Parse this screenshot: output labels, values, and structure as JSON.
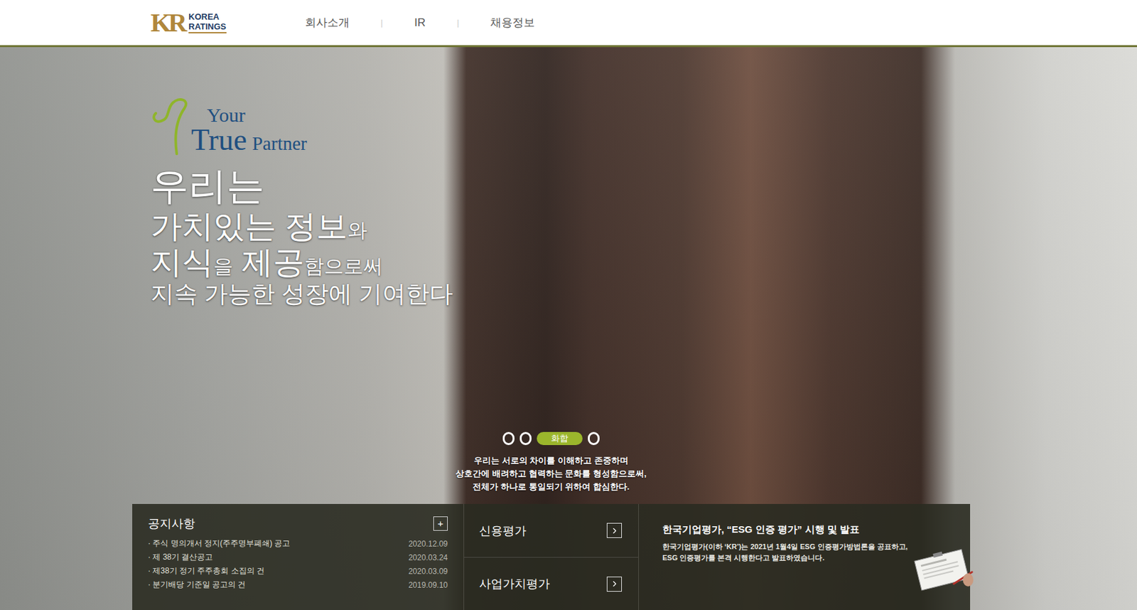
{
  "header": {
    "logo": {
      "mark": "KR",
      "name_lines": [
        "KOREA",
        "RATINGS"
      ]
    },
    "nav": [
      {
        "label": "회사소개"
      },
      {
        "label": "IR"
      },
      {
        "label": "채용정보"
      }
    ],
    "separator": "|"
  },
  "hero": {
    "tagline": {
      "small_top": "Your",
      "large": "True",
      "small_end": "Partner"
    },
    "headline": [
      [
        {
          "text": "우리는",
          "kind": "xl"
        }
      ],
      [
        {
          "text": "가치있는 정보",
          "kind": "large"
        },
        {
          "text": "와",
          "kind": "small"
        }
      ],
      [
        {
          "text": "지식",
          "kind": "large"
        },
        {
          "text": "을",
          "kind": "small"
        },
        {
          "text": " 제공",
          "kind": "large"
        },
        {
          "text": "함으로써",
          "kind": "small"
        }
      ],
      [
        {
          "text": "지속 가능한 성장에 기여한다",
          "kind": "medium"
        }
      ]
    ]
  },
  "slider": {
    "dots": [
      {
        "label": "",
        "selected": false
      },
      {
        "label": "",
        "selected": false
      },
      {
        "label": "화합",
        "selected": true
      },
      {
        "label": "",
        "selected": false
      }
    ],
    "caption": [
      "우리는 서로의 차이를 이해하고 존중하며",
      "상호간에 배려하고 협력하는 문화를 형성함으로써,",
      "전체가 하나로 통일되기 위하여 합심한다."
    ]
  },
  "notices": {
    "title": "공지사항",
    "more": "+",
    "bullet": "·",
    "items": [
      {
        "title": "주식 명의개서 정지(주주명부폐쇄) 공고",
        "date": "2020.12.09"
      },
      {
        "title": "제 38기 결산공고",
        "date": "2020.03.24"
      },
      {
        "title": "제38기 정기 주주총회 소집의 건",
        "date": "2020.03.09"
      },
      {
        "title": "분기배당 기준일 공고의 건",
        "date": "2019.09.10"
      }
    ]
  },
  "services": [
    {
      "label": "신용평가"
    },
    {
      "label": "사업가치평가"
    }
  ],
  "news": {
    "title": "한국기업평가, “ESG 인증 평가” 시행 및 발표",
    "body": [
      "한국기업평가(이하 ‘KR’)는 2021년 1월4일 ESG 인증평가방법론을 공표하고,",
      "ESG 인증평가를 본격 시행한다고 발표하였습니다."
    ]
  }
}
